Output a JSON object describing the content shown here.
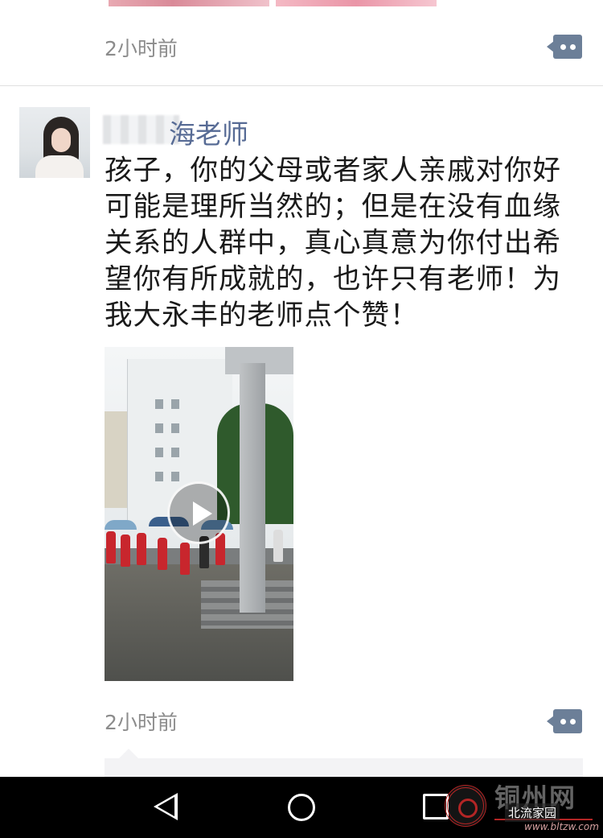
{
  "previous_post": {
    "time": "2小时前"
  },
  "post": {
    "username": "海老师",
    "text": "孩子，你的父母或者家人亲戚对你好可能是理所当然的；但是在没有血缘关系的人群中，真心真意为你付出希望你有所成就的，也许只有老师！为我大永丰的老师点个赞！",
    "time": "2小时前",
    "video_icon": "play-icon"
  },
  "navbar": {
    "back_icon": "back-triangle-icon",
    "home_icon": "home-circle-icon",
    "recent_icon": "recent-apps-square-icon"
  },
  "watermark": {
    "site": "铜州网",
    "tag": "北流家园",
    "url": "www.bltzw.com"
  },
  "colors": {
    "username": "#576b95",
    "time": "#8c8c8c",
    "comment_button": "#6c7f98",
    "navbar": "#000000"
  }
}
